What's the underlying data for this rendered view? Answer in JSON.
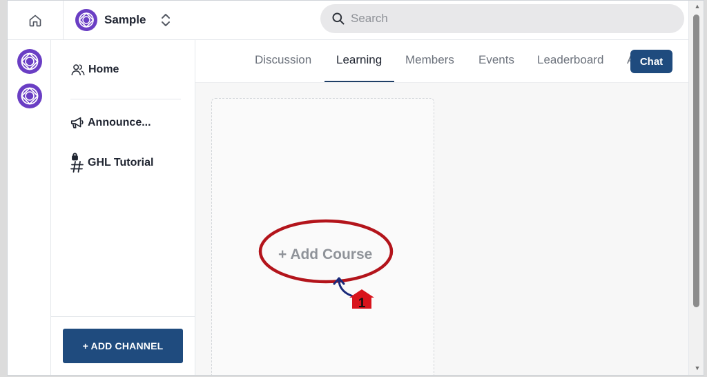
{
  "topbar": {
    "community_name": "Sample",
    "search_placeholder": "Search"
  },
  "sidebar": {
    "items": [
      {
        "label": "Home",
        "icon": "users-icon"
      },
      {
        "label": "Announce...",
        "icon": "megaphone-icon"
      },
      {
        "label": "GHL Tutorial",
        "icon": "locked-hash-icon"
      }
    ],
    "add_channel_label": "+ ADD CHANNEL"
  },
  "tabs": [
    "Discussion",
    "Learning",
    "Members",
    "Events",
    "Leaderboard",
    "A"
  ],
  "active_tab": "Learning",
  "chat_label": "Chat",
  "learning": {
    "add_course_label": "+ Add Course"
  },
  "annotation": {
    "step_number": "1"
  },
  "colors": {
    "brand_purple": "#6a3ec4",
    "primary_button": "#1f4b7e",
    "annotation_red": "#b3141b",
    "annotation_arrow": "#1a2a7a"
  }
}
